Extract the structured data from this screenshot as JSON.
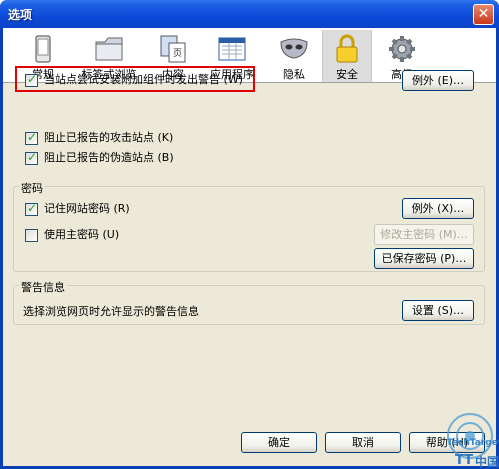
{
  "window": {
    "title": "选项",
    "close": "✕"
  },
  "toolbar": {
    "items": [
      {
        "label": "常规",
        "icon": "phone-icon"
      },
      {
        "label": "标签式浏览",
        "icon": "folder-tabs-icon"
      },
      {
        "label": "内容",
        "icon": "page-icon"
      },
      {
        "label": "应用程序",
        "icon": "window-apps-icon"
      },
      {
        "label": "隐私",
        "icon": "mask-icon"
      },
      {
        "label": "安全",
        "icon": "lock-icon"
      },
      {
        "label": "高级",
        "icon": "gear-icon"
      }
    ],
    "active": "安全"
  },
  "security": {
    "addons_label": "当站点尝试安装附加组件时发出警告 (W)",
    "addons_checked": true,
    "exceptions1": "例外 (E)…",
    "attack_label": "阻止已报告的攻击站点 (K)",
    "attack_checked": true,
    "forgery_label": "阻止已报告的伪造站点 (B)",
    "forgery_checked": true
  },
  "passwords": {
    "group_title": "密码",
    "remember_label": "记住网站密码 (R)",
    "remember_checked": true,
    "exceptions2": "例外 (X)…",
    "master_label": "使用主密码 (U)",
    "master_checked": false,
    "change_master": "修改主密码 (M)…",
    "saved_passwords": "已保存密码 (P)…"
  },
  "warnings": {
    "group_title": "警告信息",
    "description": "选择浏览网页时允许显示的警告信息",
    "settings": "设置 (S)…"
  },
  "footer": {
    "ok": "确定",
    "cancel": "取消",
    "help": "帮助 (H)"
  },
  "watermark": {
    "line1": "TechTarget",
    "line2": "中国",
    "brand": "TT"
  },
  "colors": {
    "titlebar": "#0d4ad8",
    "dialog_bg": "#ece9d8",
    "highlight": "#e00000",
    "check": "#21a121"
  }
}
